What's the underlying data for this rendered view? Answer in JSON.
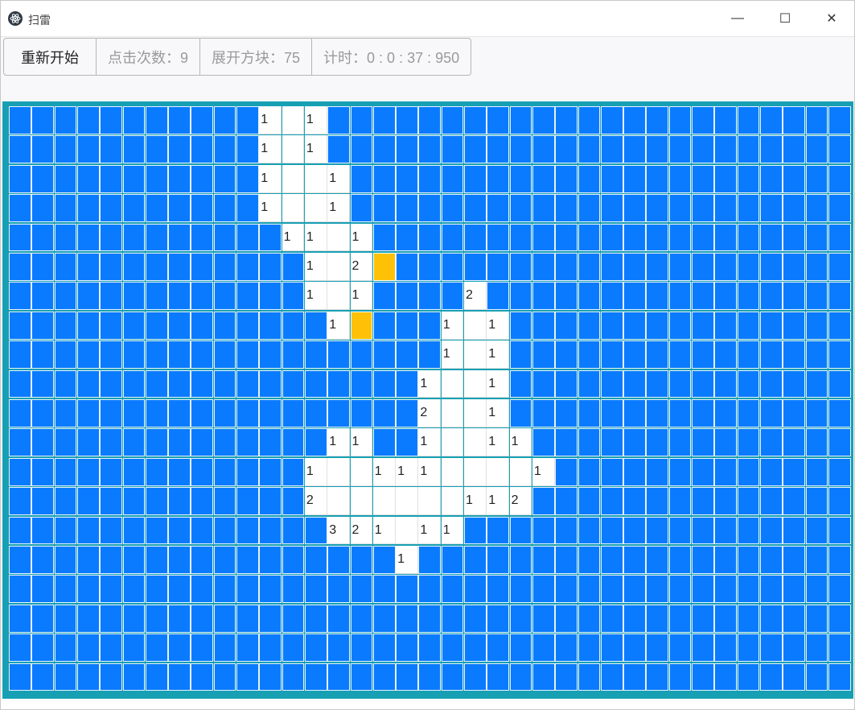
{
  "window": {
    "title": "扫雷",
    "icon": "electron-atom-icon",
    "controls": {
      "minimize": "—",
      "maximize": "☐",
      "close": "✕"
    }
  },
  "toolbar": {
    "restart_label": "重新开始",
    "clicks_label": "点击次数：9",
    "revealed_label": "展开方块：75",
    "timer_label": "计时：0 : 0 : 37 : 950"
  },
  "colors": {
    "covered": "#0a7bff",
    "revealed": "#ffffff",
    "flag": "#ffc107",
    "board_border": "#17a0b4"
  },
  "board": {
    "cols": 37,
    "rows": 20,
    "flags": [
      [
        5,
        16
      ],
      [
        7,
        15
      ]
    ],
    "revealed": [
      [
        0,
        11,
        "1"
      ],
      [
        0,
        12,
        ""
      ],
      [
        0,
        13,
        "1"
      ],
      [
        1,
        11,
        "1"
      ],
      [
        1,
        12,
        ""
      ],
      [
        1,
        13,
        "1"
      ],
      [
        2,
        11,
        "1"
      ],
      [
        2,
        12,
        ""
      ],
      [
        2,
        13,
        ""
      ],
      [
        2,
        14,
        "1"
      ],
      [
        3,
        11,
        "1"
      ],
      [
        3,
        12,
        ""
      ],
      [
        3,
        13,
        ""
      ],
      [
        3,
        14,
        "1"
      ],
      [
        4,
        12,
        "1"
      ],
      [
        4,
        13,
        "1"
      ],
      [
        4,
        14,
        ""
      ],
      [
        4,
        15,
        "1"
      ],
      [
        5,
        13,
        "1"
      ],
      [
        5,
        14,
        ""
      ],
      [
        5,
        15,
        "2"
      ],
      [
        6,
        13,
        "1"
      ],
      [
        6,
        14,
        ""
      ],
      [
        6,
        15,
        "1"
      ],
      [
        6,
        20,
        "2"
      ],
      [
        7,
        14,
        "1"
      ],
      [
        7,
        19,
        "1"
      ],
      [
        7,
        20,
        ""
      ],
      [
        7,
        21,
        "1"
      ],
      [
        8,
        19,
        "1"
      ],
      [
        8,
        20,
        ""
      ],
      [
        8,
        21,
        "1"
      ],
      [
        9,
        18,
        "1"
      ],
      [
        9,
        19,
        ""
      ],
      [
        9,
        20,
        ""
      ],
      [
        9,
        21,
        "1"
      ],
      [
        10,
        18,
        "2"
      ],
      [
        10,
        19,
        ""
      ],
      [
        10,
        20,
        ""
      ],
      [
        10,
        21,
        "1"
      ],
      [
        11,
        14,
        "1"
      ],
      [
        11,
        15,
        "1"
      ],
      [
        11,
        18,
        "1"
      ],
      [
        11,
        19,
        ""
      ],
      [
        11,
        20,
        ""
      ],
      [
        11,
        21,
        "1"
      ],
      [
        11,
        22,
        "1"
      ],
      [
        12,
        13,
        "1"
      ],
      [
        12,
        14,
        ""
      ],
      [
        12,
        15,
        ""
      ],
      [
        12,
        16,
        "1"
      ],
      [
        12,
        17,
        "1"
      ],
      [
        12,
        18,
        "1"
      ],
      [
        12,
        19,
        ""
      ],
      [
        12,
        20,
        ""
      ],
      [
        12,
        21,
        ""
      ],
      [
        12,
        22,
        ""
      ],
      [
        12,
        23,
        "1"
      ],
      [
        13,
        13,
        "2"
      ],
      [
        13,
        14,
        ""
      ],
      [
        13,
        15,
        ""
      ],
      [
        13,
        16,
        ""
      ],
      [
        13,
        17,
        ""
      ],
      [
        13,
        18,
        ""
      ],
      [
        13,
        19,
        ""
      ],
      [
        13,
        20,
        "1"
      ],
      [
        13,
        21,
        "1"
      ],
      [
        13,
        22,
        "2"
      ],
      [
        14,
        14,
        "3"
      ],
      [
        14,
        15,
        "2"
      ],
      [
        14,
        16,
        "1"
      ],
      [
        14,
        17,
        ""
      ],
      [
        14,
        18,
        "1"
      ],
      [
        14,
        19,
        "1"
      ],
      [
        15,
        17,
        "1"
      ]
    ]
  }
}
